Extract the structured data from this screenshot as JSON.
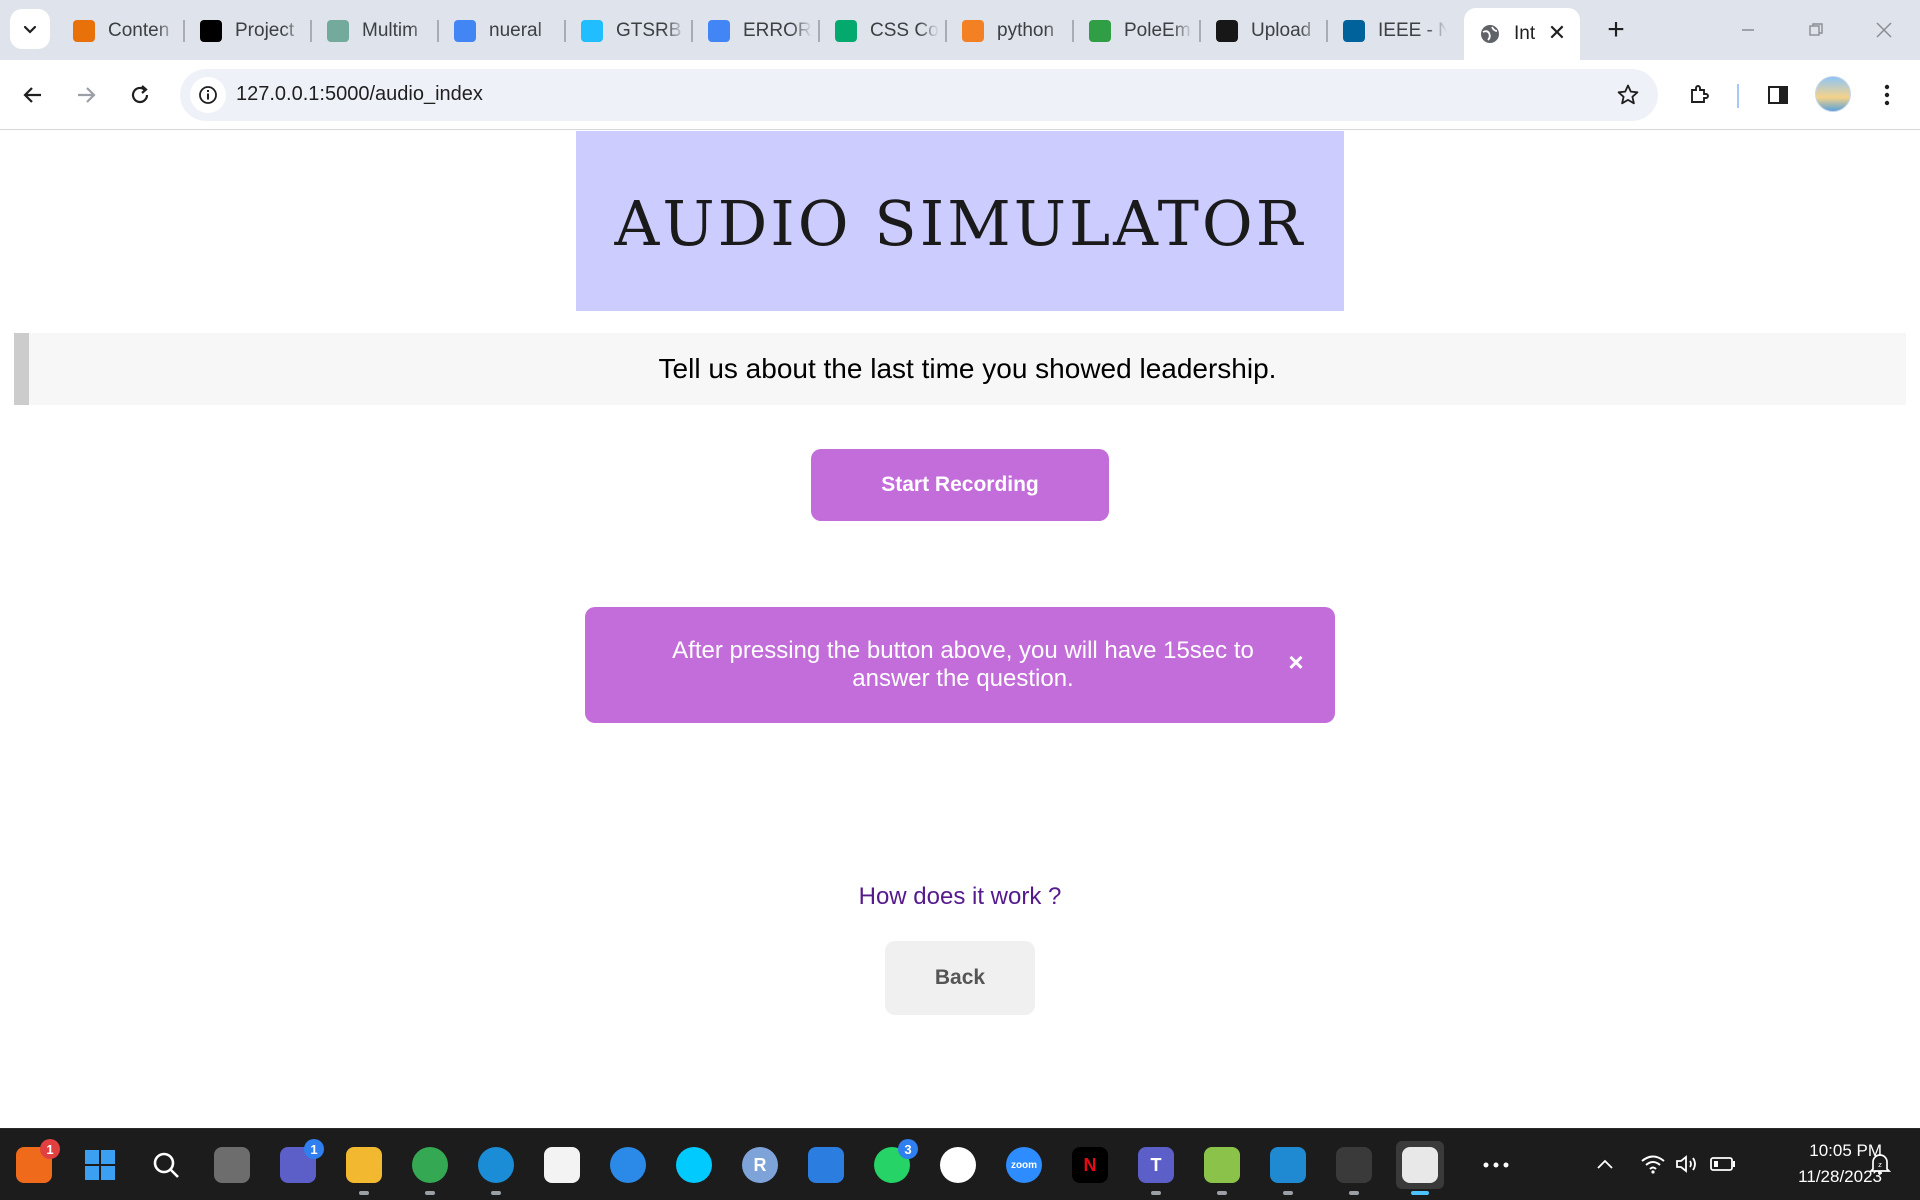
{
  "browser": {
    "tabs": [
      {
        "title": "Conten",
        "icon": "bar-chart-icon",
        "color": "#e8710a"
      },
      {
        "title": "Project",
        "icon": "blackboard-icon",
        "color": "#000000"
      },
      {
        "title": "Multim",
        "icon": "openai-icon",
        "color": "#74aa9c"
      },
      {
        "title": "nueral",
        "icon": "google-icon",
        "color": "#4285f4"
      },
      {
        "title": "GTSRB",
        "icon": "kaggle-icon",
        "color": "#20beff"
      },
      {
        "title": "ERROR",
        "icon": "google-icon",
        "color": "#4285f4"
      },
      {
        "title": "CSS Co",
        "icon": "w3schools-icon",
        "color": "#04aa6d"
      },
      {
        "title": "python",
        "icon": "stackoverflow-icon",
        "color": "#f48024"
      },
      {
        "title": "PoleEm",
        "icon": "leaf-icon",
        "color": "#2f9e44"
      },
      {
        "title": "Upload",
        "icon": "github-icon",
        "color": "#181717"
      },
      {
        "title": "IEEE - N",
        "icon": "ieee-icon",
        "color": "#00629b"
      }
    ],
    "active_tab": {
      "title": "Int",
      "icon": "globe-icon"
    },
    "url": "127.0.0.1:5000/audio_index"
  },
  "page": {
    "header_title": "AUDIO SIMULATOR",
    "question": "Tell us about the last time you showed leadership.",
    "record_button": "Start Recording",
    "alert_text": "After pressing the button above, you will have 15sec to answer the question.",
    "alert_close": "×",
    "how_link": "How does it work ?",
    "back_button": "Back",
    "colors": {
      "header_bg": "#ccccff",
      "accent": "#c36ddb",
      "link": "#551a8b"
    }
  },
  "taskbar": {
    "apps": [
      {
        "name": "firefox-nightly-icon",
        "badge": "1"
      },
      {
        "name": "windows-start-icon"
      },
      {
        "name": "search-icon"
      },
      {
        "name": "task-view-icon"
      },
      {
        "name": "teams-chat-icon",
        "badge": "1"
      },
      {
        "name": "file-explorer-icon"
      },
      {
        "name": "chrome-icon"
      },
      {
        "name": "edge-icon"
      },
      {
        "name": "microsoft-store-icon"
      },
      {
        "name": "get-help-icon"
      },
      {
        "name": "alexa-icon"
      },
      {
        "name": "r-icon",
        "label": "R"
      },
      {
        "name": "mail-icon"
      },
      {
        "name": "whatsapp-icon",
        "badge": "3"
      },
      {
        "name": "mongodb-icon"
      },
      {
        "name": "zoom-icon",
        "label": "zoom"
      },
      {
        "name": "netflix-icon",
        "label": "N"
      },
      {
        "name": "teams-icon",
        "label": "T"
      },
      {
        "name": "notepad-icon"
      },
      {
        "name": "vscode-icon"
      },
      {
        "name": "terminal-icon"
      },
      {
        "name": "snipping-tool-icon"
      },
      {
        "name": "more-apps-icon"
      }
    ],
    "time": "10:05 PM",
    "date": "11/28/2023"
  }
}
